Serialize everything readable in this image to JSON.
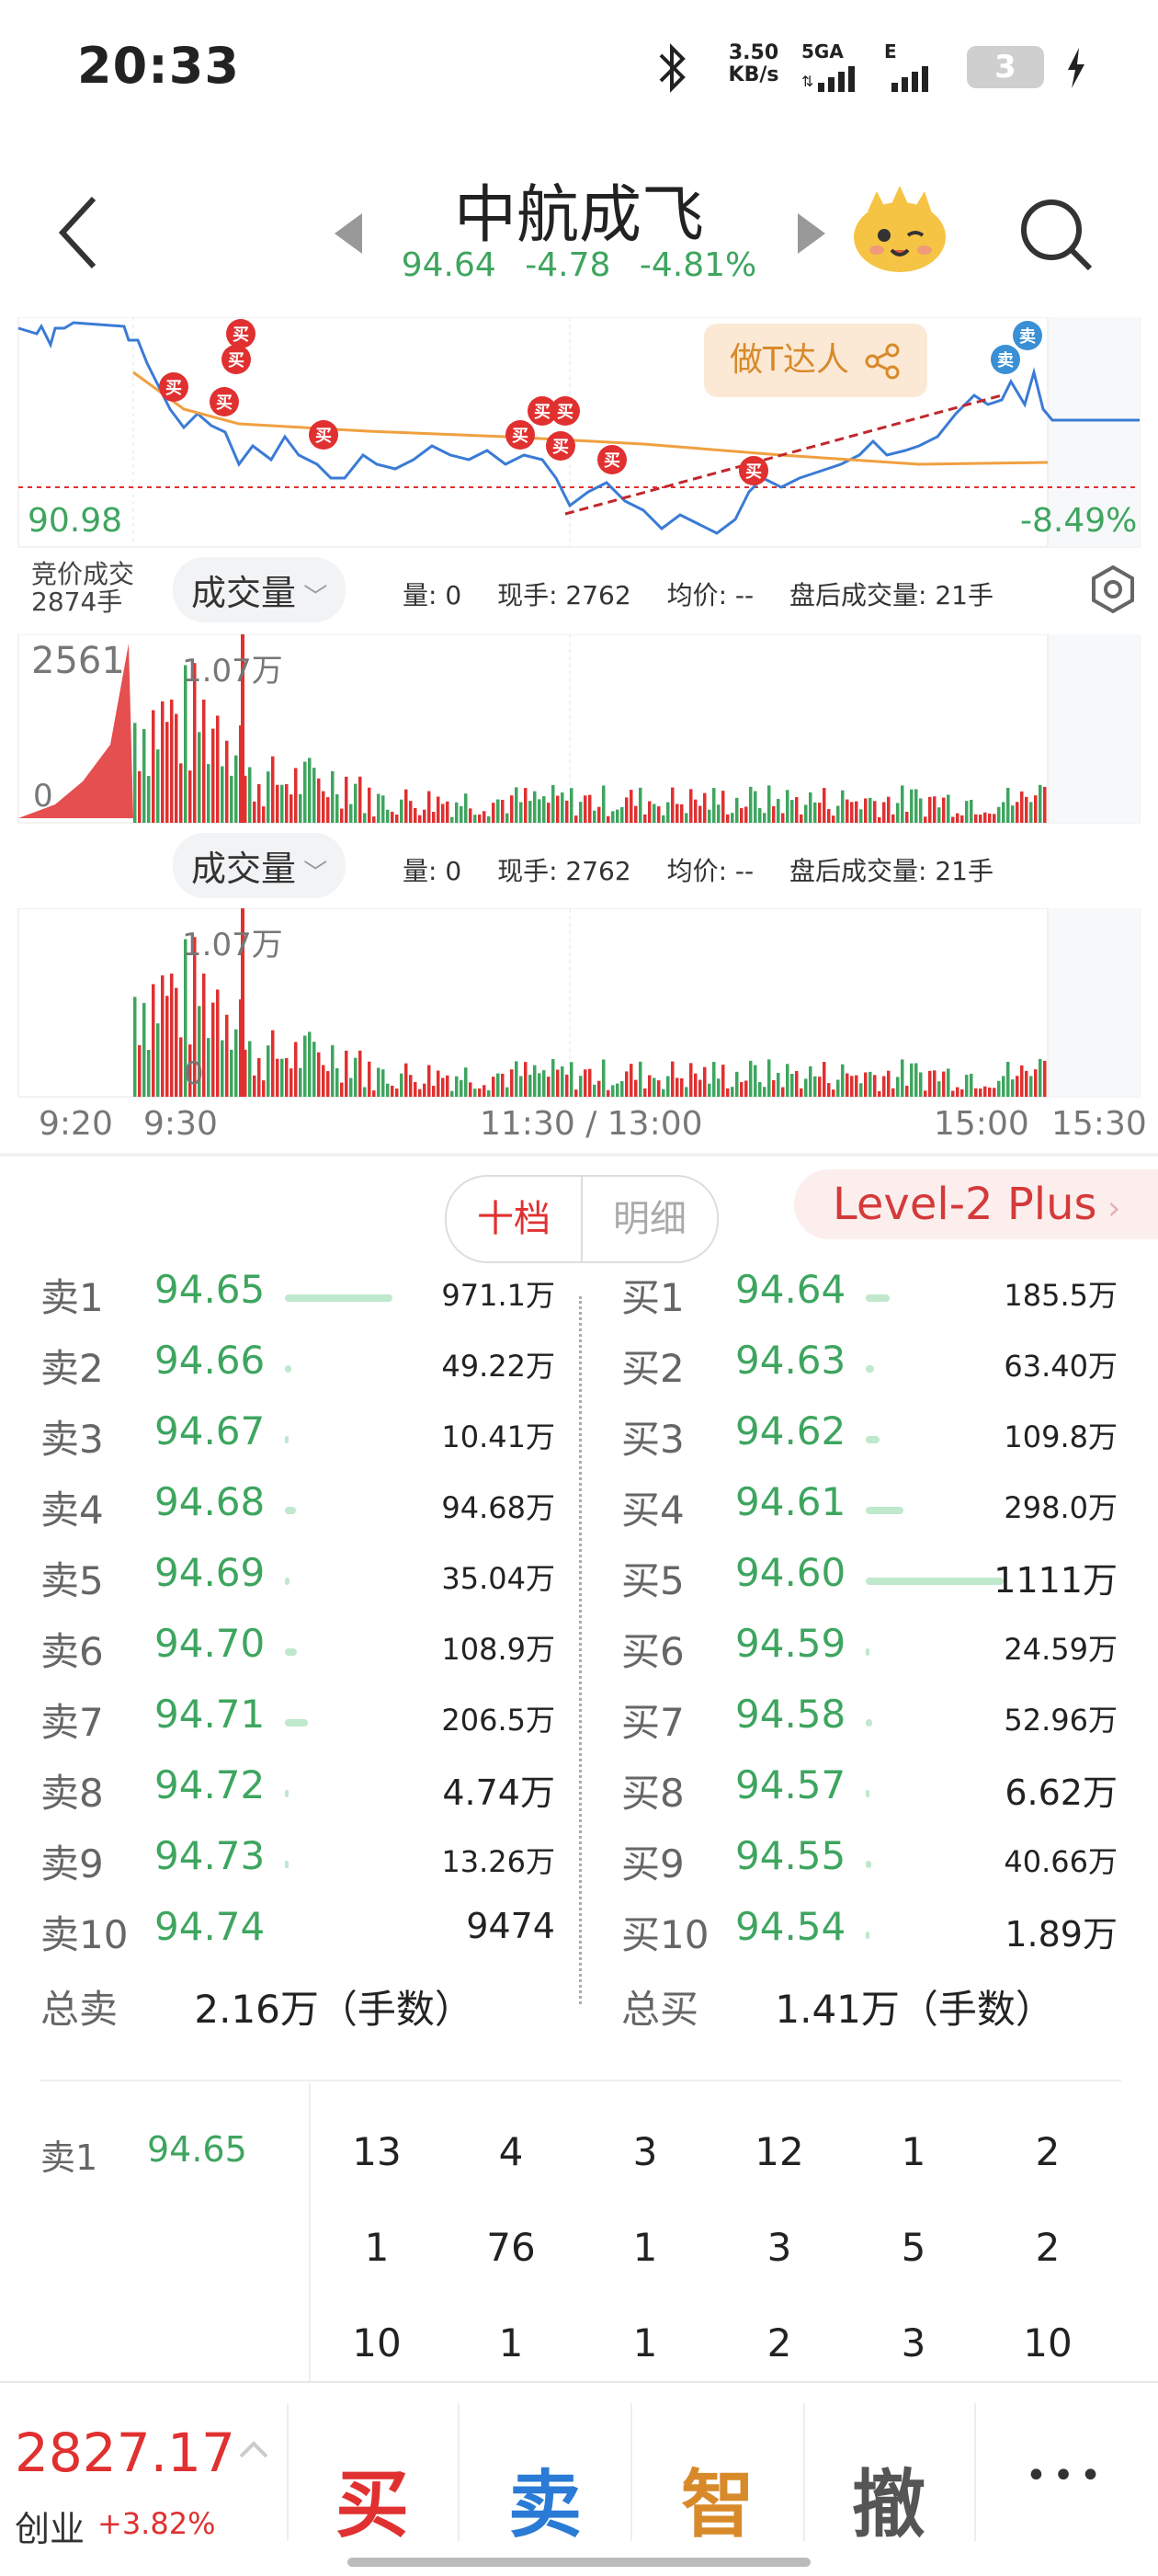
{
  "status_bar": {
    "time": "20:33",
    "net_speed": "3.50",
    "net_unit": "KB/s",
    "sig1": "5GA",
    "sig2": "E",
    "battery": "3"
  },
  "header": {
    "title": "中航成飞",
    "price": "94.64",
    "change": "-4.78",
    "change_pct": "-4.81%"
  },
  "chart": {
    "badge": "做T达人",
    "low_price": "90.98",
    "low_pct": "-8.49%",
    "auction_label": "竞价成交",
    "auction_volume": "2874手",
    "markers_buy": [
      "买",
      "买",
      "买",
      "买",
      "买",
      "买",
      "买",
      "买",
      "买",
      "买",
      "买"
    ],
    "markers_sell": [
      "卖",
      "卖"
    ]
  },
  "volume_panel": {
    "selector": "成交量",
    "qty": "量: 0",
    "current_hand": "现手: 2762",
    "avg_price": "均价: --",
    "after_hours": "盘后成交量: 21手",
    "ymax_left": "2561",
    "ymax": "1.07万",
    "zero": "0"
  },
  "time_axis": [
    "9:20",
    "9:30",
    "11:30 / 13:00",
    "15:00",
    "15:30"
  ],
  "tabs": {
    "tab1": "十档",
    "tab2": "明细",
    "level2": "Level-2 Plus"
  },
  "order_book": {
    "sell": [
      {
        "label": "卖1",
        "price": "94.65",
        "vol": "971.1万",
        "bar": 0.9
      },
      {
        "label": "卖2",
        "price": "94.66",
        "vol": "49.22万",
        "bar": 0.05
      },
      {
        "label": "卖3",
        "price": "94.67",
        "vol": "10.41万",
        "bar": 0.01
      },
      {
        "label": "卖4",
        "price": "94.68",
        "vol": "94.68万",
        "bar": 0.09
      },
      {
        "label": "卖5",
        "price": "94.69",
        "vol": "35.04万",
        "bar": 0.035
      },
      {
        "label": "卖6",
        "price": "94.70",
        "vol": "108.9万",
        "bar": 0.1
      },
      {
        "label": "卖7",
        "price": "94.71",
        "vol": "206.5万",
        "bar": 0.19
      },
      {
        "label": "卖8",
        "price": "94.72",
        "vol": "4.74万",
        "bar": 0.005
      },
      {
        "label": "卖9",
        "price": "94.73",
        "vol": "13.26万",
        "bar": 0.012
      },
      {
        "label": "卖10",
        "price": "94.74",
        "vol": "9474",
        "bar": 0
      }
    ],
    "buy": [
      {
        "label": "买1",
        "price": "94.64",
        "vol": "185.5万",
        "bar": 0.17
      },
      {
        "label": "买2",
        "price": "94.63",
        "vol": "63.40万",
        "bar": 0.06
      },
      {
        "label": "买3",
        "price": "94.62",
        "vol": "109.8万",
        "bar": 0.1
      },
      {
        "label": "买4",
        "price": "94.61",
        "vol": "298.0万",
        "bar": 0.27
      },
      {
        "label": "买5",
        "price": "94.60",
        "vol": "1111万",
        "bar": 1.0
      },
      {
        "label": "买6",
        "price": "94.59",
        "vol": "24.59万",
        "bar": 0.022
      },
      {
        "label": "买7",
        "price": "94.58",
        "vol": "52.96万",
        "bar": 0.048
      },
      {
        "label": "买8",
        "price": "94.57",
        "vol": "6.62万",
        "bar": 0.006
      },
      {
        "label": "买9",
        "price": "94.55",
        "vol": "40.66万",
        "bar": 0.037
      },
      {
        "label": "买10",
        "price": "94.54",
        "vol": "1.89万",
        "bar": 0.002
      }
    ],
    "total_sell_label": "总卖",
    "total_sell": "2.16万（手数）",
    "total_buy_label": "总买",
    "total_buy": "1.41万（手数）"
  },
  "queue": {
    "label": "卖1",
    "price": "94.65",
    "rows": [
      [
        "13",
        "4",
        "3",
        "12",
        "1",
        "2"
      ],
      [
        "1",
        "76",
        "1",
        "3",
        "5",
        "2"
      ],
      [
        "10",
        "1",
        "1",
        "2",
        "3",
        "10"
      ]
    ]
  },
  "bottom_bar": {
    "index_value": "2827.17",
    "index_name": "创业",
    "index_change": "+3.82%",
    "buy": "买",
    "sell": "卖",
    "smart": "智",
    "cancel": "撤",
    "more": "•••"
  },
  "colors": {
    "up": "#e03030",
    "down": "#3ea55f",
    "price_line": "#3a7bd5",
    "avg_line": "#f0a040",
    "accent_orange": "#d88a2a"
  }
}
